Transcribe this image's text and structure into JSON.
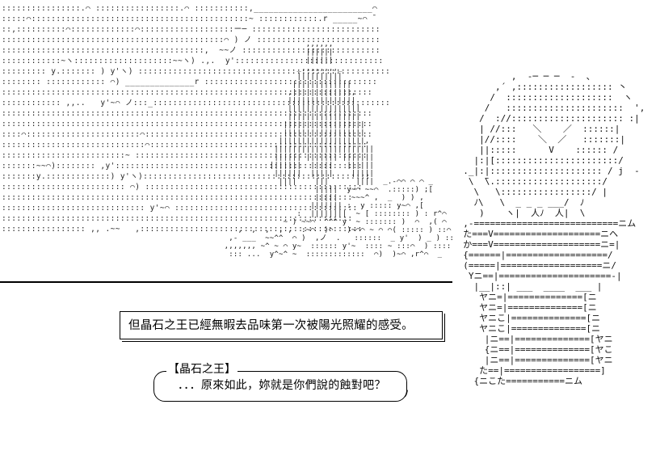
{
  "scene": {
    "caption": "但晶石之王已經無暇去品味第一次被陽光照耀的感受。",
    "speaker_label": "【晶石之王】",
    "dialogue": "．．．原來如此，妳就是你們說的蝕對吧？"
  },
  "art": {
    "sky_label": "Clouds and sky drawn in dotted ASCII art",
    "statue_label": "Tall pillar / statue drawn in ASCII art",
    "figure_label": "Character in layered robes drawn in ASCII art"
  }
}
